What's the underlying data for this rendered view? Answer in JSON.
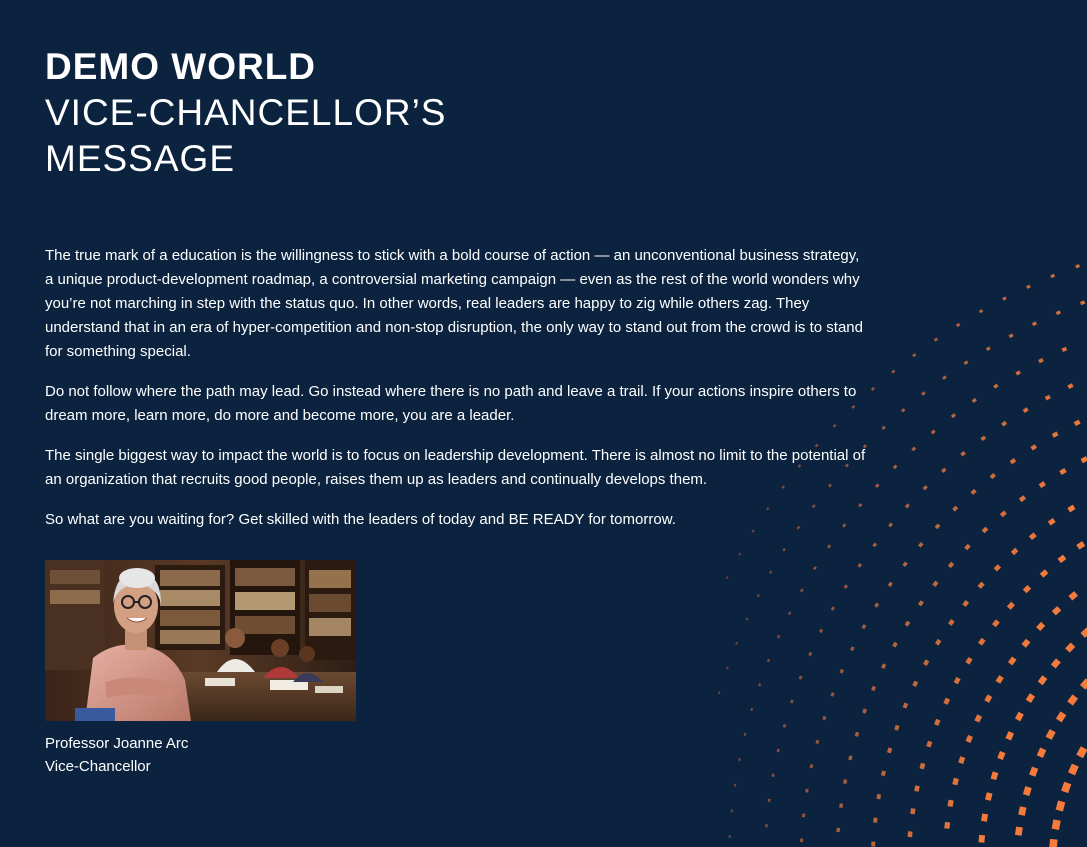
{
  "header": {
    "title_bold": "DEMO WORLD",
    "title_rest_line1": "VICE-CHANCELLOR’S",
    "title_rest_line2": "MESSAGE"
  },
  "message": {
    "paragraphs": [
      "The true mark of a education is the willingness to stick with a bold course of action — an unconventional business strategy, a unique product-development roadmap, a controversial marketing campaign — even as the rest of the world wonders why you’re not marching in step with the status quo. In other words, real leaders are happy to zig while others zag. They understand that in an era of hyper-competition and non-stop disruption, the only way to stand out from the crowd is to stand for something special.",
      "Do not follow where the path may lead. Go instead where there is no path and leave a trail. If your actions inspire others to dream more, learn more, do more and become more, you are a leader.",
      "The single biggest way to impact the world is to focus on leadership development. There is almost no limit to the potential of an organization that recruits good people, raises them up as leaders and continually develops them.",
      "So what are you waiting for? Get skilled with the leaders of today and BE READY for tomorrow."
    ]
  },
  "signature": {
    "name": "Professor Joanne Arc",
    "role": "Vice-Chancellor"
  },
  "colors": {
    "background": "#0c2340",
    "accent": "#f47b3c",
    "text": "#ffffff"
  }
}
